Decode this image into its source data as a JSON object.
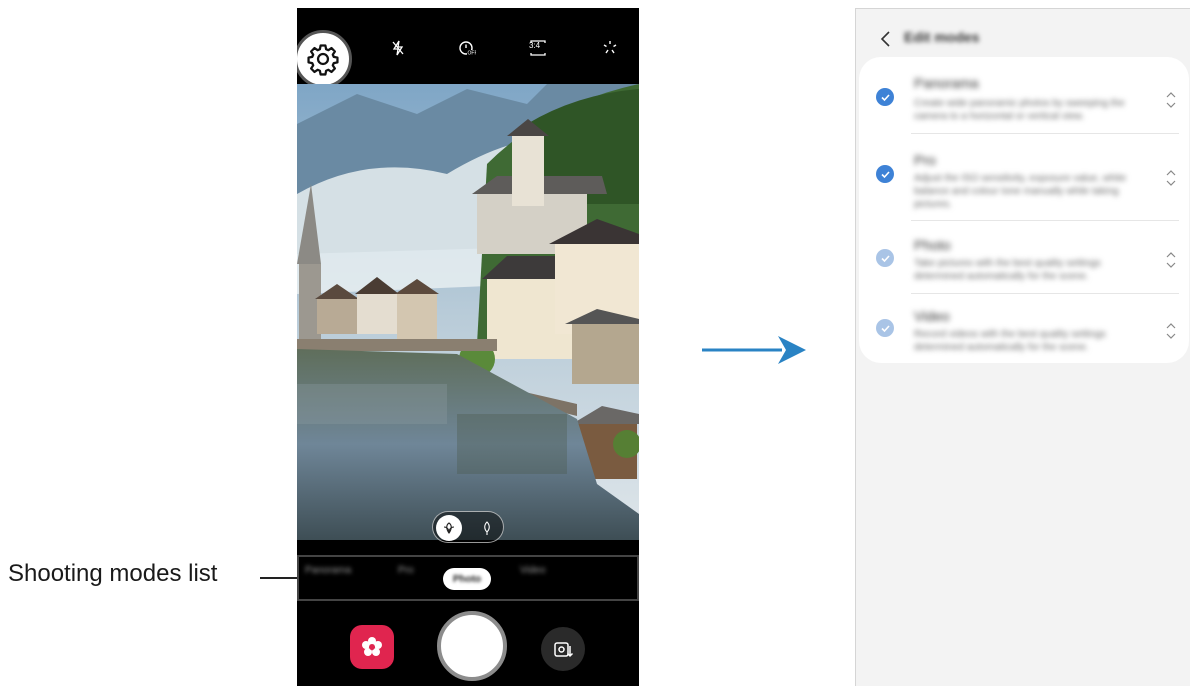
{
  "callout": {
    "label": "Shooting modes list"
  },
  "camera": {
    "top_icons": [
      "gear-icon",
      "flash-off-icon",
      "timer-off-icon",
      "ratio-icon",
      "filter-icon"
    ],
    "ratio_text": "3:4",
    "modes": [
      "Panorama",
      "Pro",
      "Photo",
      "Video"
    ],
    "active_mode": "Photo"
  },
  "edit_modes": {
    "title": "Edit modes",
    "items": [
      {
        "name": "Panorama",
        "desc": "Create wide panoramic photos by sweeping the camera to a horizontal or vertical view.",
        "checked": true,
        "enabled": true
      },
      {
        "name": "Pro",
        "desc": "Adjust the ISO sensitivity, exposure value, white balance and colour tone manually while taking pictures.",
        "checked": true,
        "enabled": true
      },
      {
        "name": "Photo",
        "desc": "Take pictures with the best quality settings determined automatically for the scene.",
        "checked": true,
        "enabled": false
      },
      {
        "name": "Video",
        "desc": "Record videos with the best quality settings determined automatically for the scene.",
        "checked": true,
        "enabled": false
      }
    ]
  },
  "colors": {
    "accent": "#3e82d6",
    "accent_disabled": "#a9c4e6",
    "gallery": "#e0254f"
  }
}
